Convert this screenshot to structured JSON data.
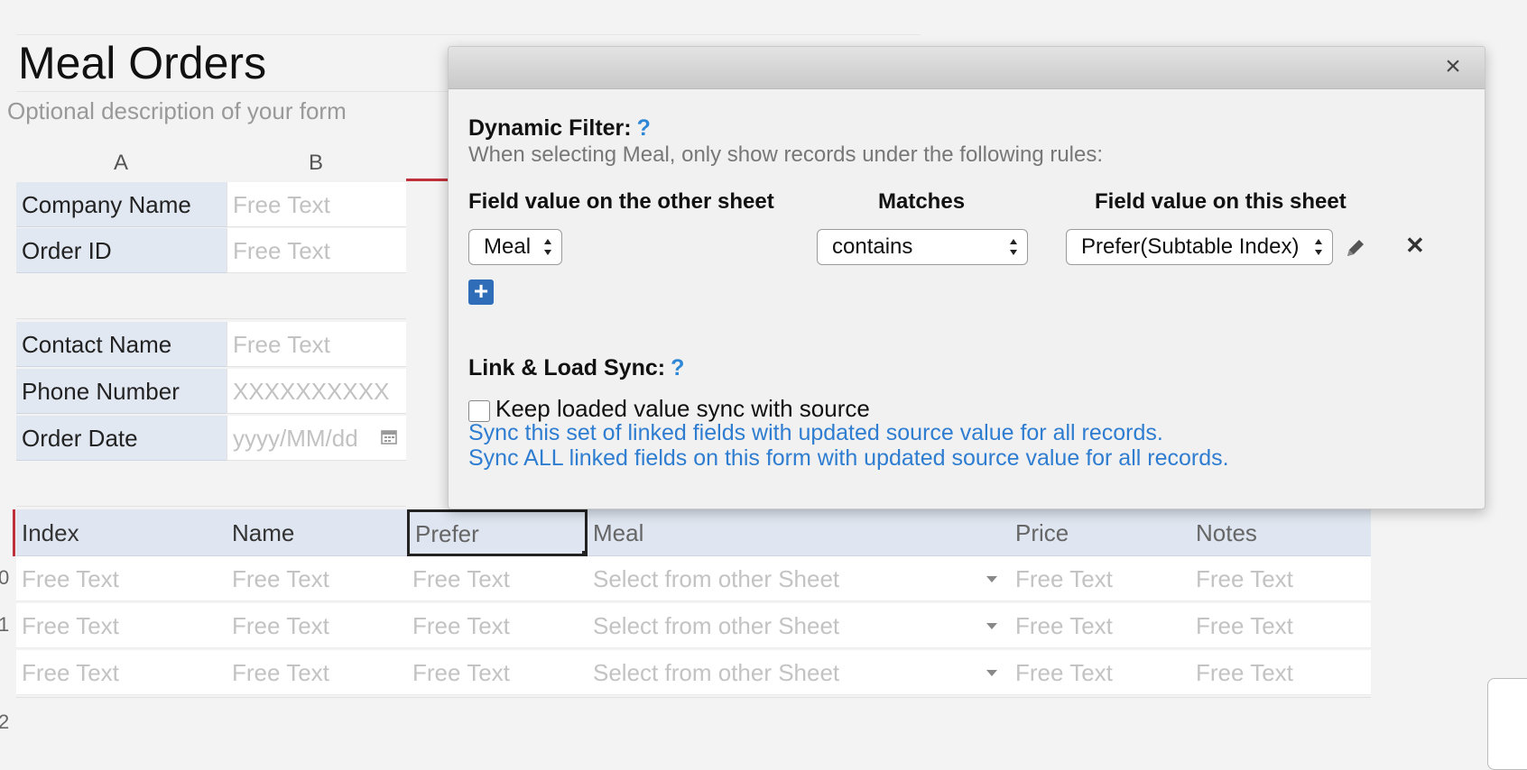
{
  "form": {
    "title": "Meal Orders",
    "description_placeholder": "Optional description of your form"
  },
  "columns": [
    "A",
    "B"
  ],
  "header_fields": [
    {
      "label": "Company Name",
      "value": "Free Text"
    },
    {
      "label": "Order ID",
      "value": "Free Text"
    },
    {
      "label": "Contact Name",
      "value": "Free Text"
    },
    {
      "label": "Phone Number",
      "value": "XXXXXXXXXX"
    },
    {
      "label": "Order Date",
      "value": "yyyy/MM/dd"
    }
  ],
  "subtable": {
    "headers": [
      "Index",
      "Name",
      "Prefer",
      "Meal",
      "Price",
      "Notes"
    ],
    "rows": [
      {
        "num": "",
        "cells": [
          "Free Text",
          "Free Text",
          "Free Text",
          "Select from other Sheet",
          "Free Text",
          "Free Text"
        ]
      },
      {
        "num": "0",
        "cells": [
          "Free Text",
          "Free Text",
          "Free Text",
          "Select from other Sheet",
          "Free Text",
          "Free Text"
        ]
      },
      {
        "num": "1",
        "cells": [
          "Free Text",
          "Free Text",
          "Free Text",
          "Select from other Sheet",
          "Free Text",
          "Free Text"
        ]
      }
    ],
    "next_row_num": "2"
  },
  "modal": {
    "dynamic_filter_title": "Dynamic Filter:",
    "help_mark": "?",
    "dynamic_filter_desc": "When selecting Meal, only show records under the following rules:",
    "col_other": "Field value on the other sheet",
    "col_matches": "Matches",
    "col_this": "Field value on this sheet",
    "rule": {
      "other_field": "Meal",
      "operator": "contains",
      "this_field": "Prefer(Subtable Index)"
    },
    "link_sync_title": "Link & Load Sync:",
    "keep_sync_label": "Keep loaded value sync with source",
    "keep_sync_checked": false,
    "sync_set_link": "Sync this set of linked fields with updated source value for all records.",
    "sync_all_link": "Sync ALL linked fields on this form with updated source value for all records.",
    "close_glyph": "×",
    "remove_glyph": "✕",
    "add_glyph": "+"
  },
  "colors": {
    "accent": "#2e86d6",
    "link": "#2e7dd1",
    "label_bg": "#e2e8f2",
    "selection_red": "#c0303a"
  }
}
